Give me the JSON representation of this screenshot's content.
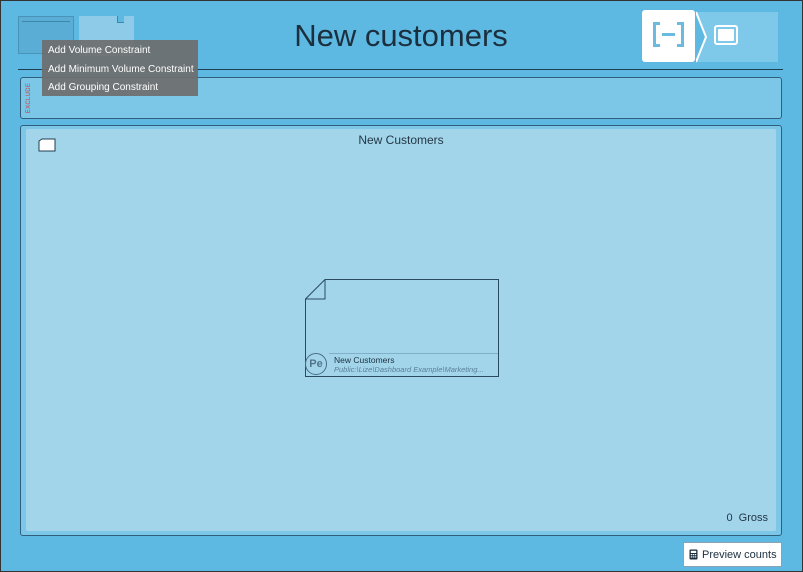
{
  "page": {
    "title": "New customers"
  },
  "context_menu": {
    "items": [
      {
        "label": "Add Volume Constraint"
      },
      {
        "label": "Add Minimum Volume Constraint"
      },
      {
        "label": "Add Grouping Constraint"
      }
    ]
  },
  "exclude_panel": {
    "label": "EXCLUDE"
  },
  "canvas": {
    "title": "New Customers",
    "node": {
      "avatar_initials": "Pe",
      "name": "New Customers",
      "path": "Public:\\Lize\\Dashboard Example\\Marketing..."
    },
    "count": {
      "value": "0",
      "unit": "Gross"
    }
  },
  "toolbar": {
    "preview_label": "Preview counts"
  },
  "icons": {
    "view_toggle_left": "bracket-icon",
    "view_toggle_right": "window-icon",
    "folder": "folder-icon",
    "calculator": "calculator-icon"
  },
  "colors": {
    "background": "#5db8e2",
    "panel": "#7cc6e8",
    "canvas": "#a2d5ea",
    "exclude_text": "#d03a3a",
    "menu": "#6e6e6e"
  }
}
